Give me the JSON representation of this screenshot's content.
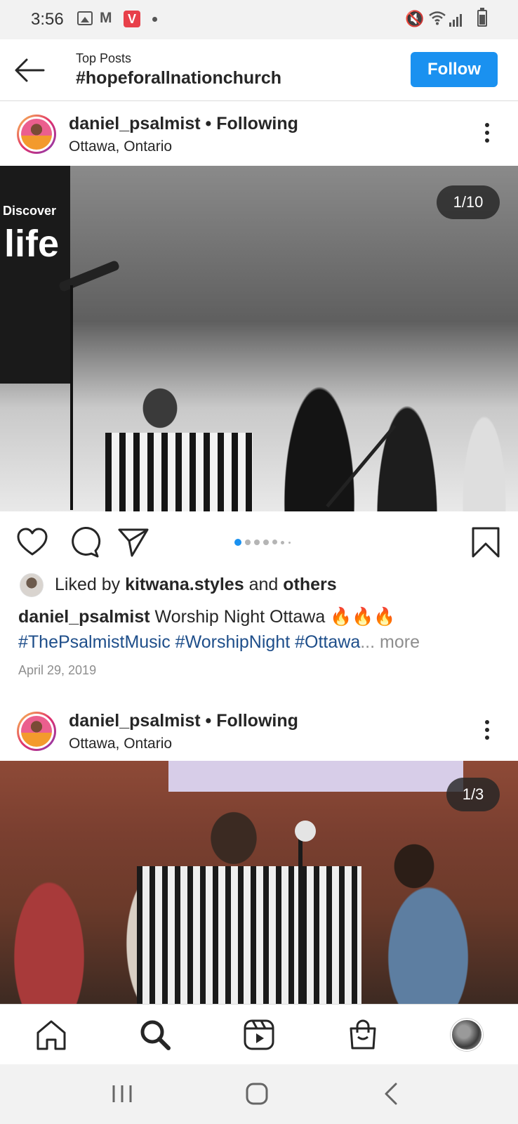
{
  "status_bar": {
    "time": "3:56",
    "mail_glyph": "M",
    "app_badge": "V",
    "icons": [
      "gallery-icon",
      "gmail-icon",
      "vivaldi-icon",
      "notification-dot-icon",
      "mute-icon",
      "wifi-icon",
      "signal-icon",
      "battery-icon"
    ]
  },
  "header": {
    "subtitle": "Top Posts",
    "title": "#hopeforallnationchurch",
    "follow_label": "Follow"
  },
  "posts": [
    {
      "username": "daniel_psalmist",
      "separator": "•",
      "following": "Following",
      "location": "Ottawa, Ontario",
      "counter": "1/10",
      "banner_small": "Discover",
      "banner_large": "life",
      "liked_prefix": "Liked by",
      "liked_by": "kitwana.styles",
      "liked_and": "and",
      "liked_others": "others",
      "caption_user": "daniel_psalmist",
      "caption_text": "Worship Night Ottawa 🔥🔥🔥",
      "caption_tags": "#ThePsalmistMusic #WorshipNight #Ottawa",
      "caption_more": "... more",
      "date": "April 29, 2019"
    },
    {
      "username": "daniel_psalmist",
      "separator": "•",
      "following": "Following",
      "location": "Ottawa, Ontario",
      "counter": "1/3"
    }
  ],
  "colors": {
    "accent": "#1a91f0",
    "hashtag": "#1e4e8a",
    "active_dot": "#1a91f0",
    "muted": "#8e8e8e"
  },
  "bottom_nav": [
    "home-icon",
    "search-icon",
    "reels-icon",
    "shop-icon",
    "profile-avatar"
  ],
  "system_nav": [
    "recents-icon",
    "home-circle-icon",
    "back-chevron-icon"
  ]
}
